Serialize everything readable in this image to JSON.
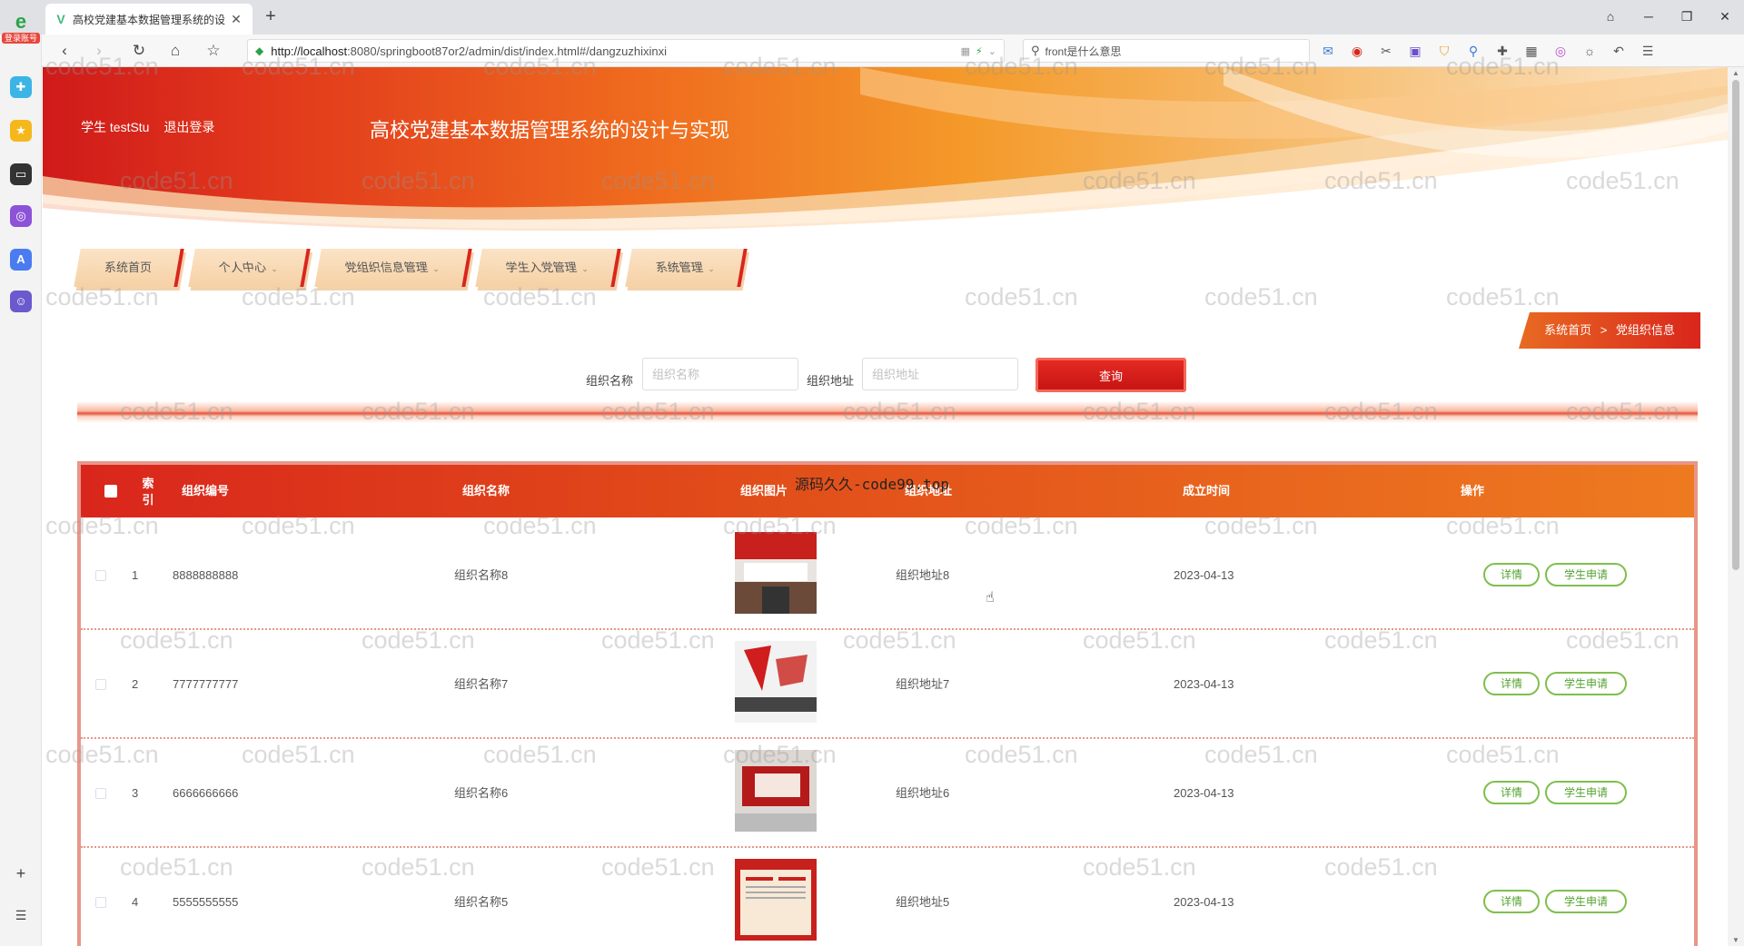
{
  "browser": {
    "tab_title": "高校党建基本数据管理系统的设",
    "url_host": "http://localhost",
    "url_rest": ":8080/springboot87or2/admin/dist/index.html#/dangzuzhixinxi",
    "search_text": "front是什么意思",
    "sidebar_badge": "登录账号"
  },
  "header": {
    "user_label": "学生 testStu",
    "logout_label": "退出登录",
    "site_title": "高校党建基本数据管理系统的设计与实现"
  },
  "menu": [
    {
      "label": "系统首页",
      "has_caret": false
    },
    {
      "label": "个人中心",
      "has_caret": true
    },
    {
      "label": "党组织信息管理",
      "has_caret": true
    },
    {
      "label": "学生入党管理",
      "has_caret": true
    },
    {
      "label": "系统管理",
      "has_caret": true
    }
  ],
  "breadcrumb": {
    "home": "系统首页",
    "separator": ">",
    "current": "党组织信息"
  },
  "search": {
    "name_label": "组织名称",
    "name_placeholder": "组织名称",
    "address_label": "组织地址",
    "address_placeholder": "组织地址",
    "query_label": "查询"
  },
  "table": {
    "headers": {
      "index": "索引",
      "code": "组织编号",
      "name": "组织名称",
      "image": "组织图片",
      "address": "组织地址",
      "created": "成立时间",
      "actions": "操作"
    },
    "rows": [
      {
        "index": "1",
        "code": "8888888888",
        "name": "组织名称8",
        "address": "组织地址8",
        "created": "2023-04-13"
      },
      {
        "index": "2",
        "code": "7777777777",
        "name": "组织名称7",
        "address": "组织地址7",
        "created": "2023-04-13"
      },
      {
        "index": "3",
        "code": "6666666666",
        "name": "组织名称6",
        "address": "组织地址6",
        "created": "2023-04-13"
      },
      {
        "index": "4",
        "code": "5555555555",
        "name": "组织名称5",
        "address": "组织地址5",
        "created": "2023-04-13"
      }
    ],
    "detail_label": "详情",
    "apply_label": "学生申请"
  },
  "overlay_text": "源码久久-code99.top",
  "watermark": "code51.cn"
}
